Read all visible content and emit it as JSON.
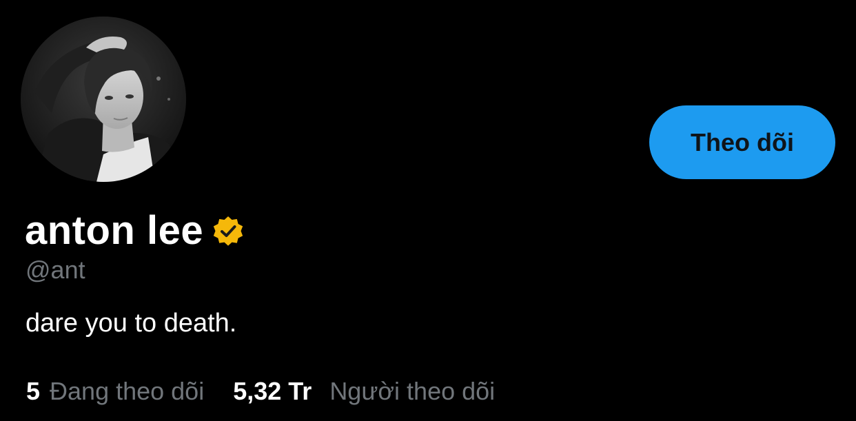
{
  "profile": {
    "display_name": "anton lee",
    "handle": "@ant",
    "bio": "dare you to death.",
    "verified": true,
    "verified_badge_color": "#f5b80a",
    "avatar_icon": "profile-photo-avatar"
  },
  "actions": {
    "follow_label": "Theo dõi",
    "follow_color": "#1d9bf0"
  },
  "stats": {
    "following_count": "5",
    "following_label": "Đang theo dõi",
    "followers_count": "5,32 Tr",
    "followers_label": "Người theo dõi"
  },
  "colors": {
    "background": "#000000",
    "primary_text": "#ffffff",
    "secondary_text": "#71767b"
  }
}
